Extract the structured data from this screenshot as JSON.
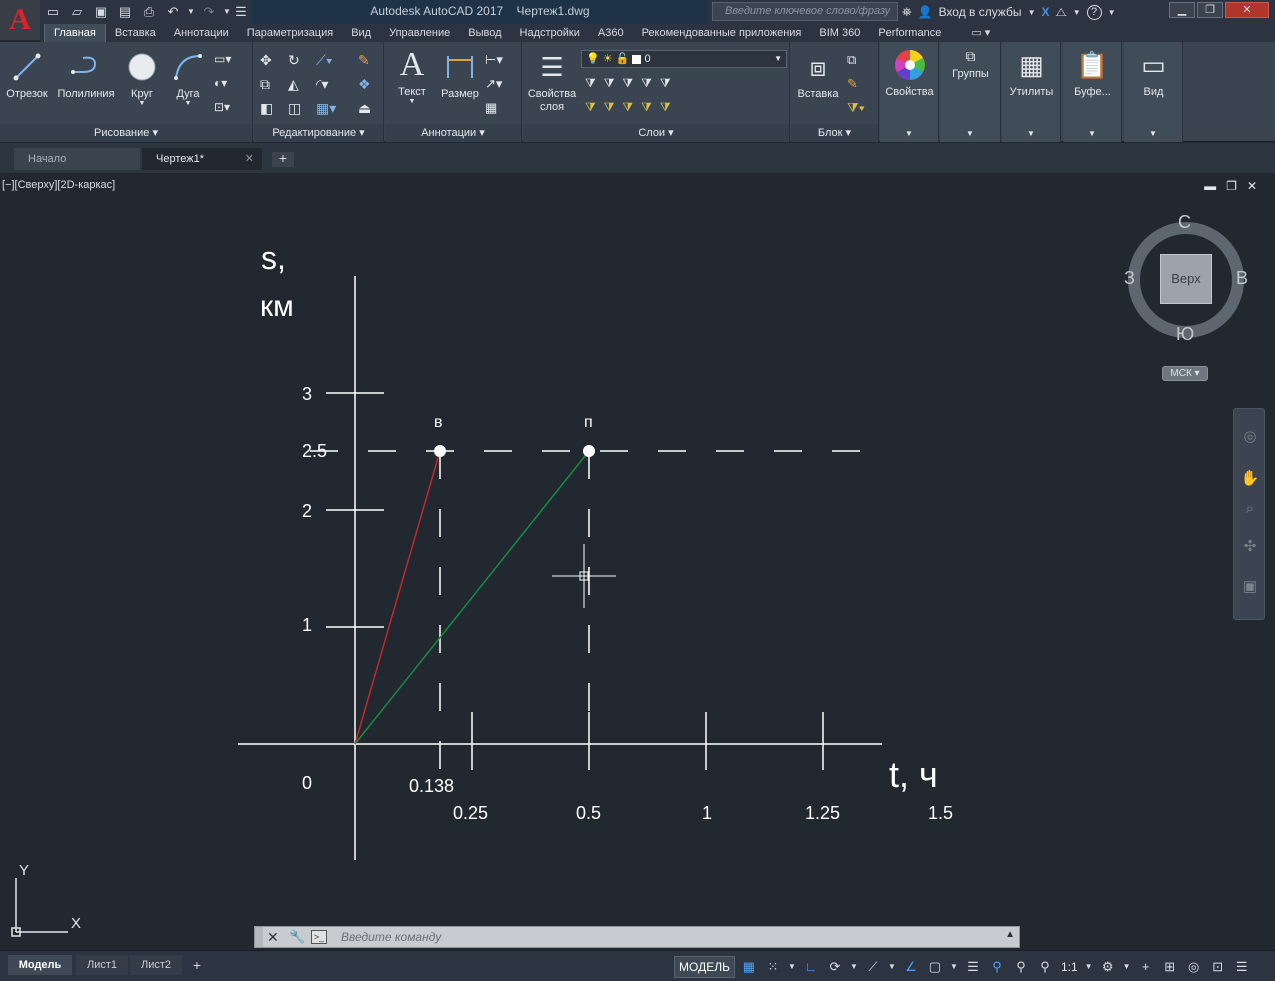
{
  "titlebar": {
    "app_title": "Autodesk AutoCAD 2017",
    "doc_name": "Чертеж1.dwg",
    "search_placeholder": "Введите ключевое слово/фразу",
    "sign_in": "Вход в службы",
    "help": "?"
  },
  "ribbon_tabs": [
    "Главная",
    "Вставка",
    "Аннотации",
    "Параметризация",
    "Вид",
    "Управление",
    "Вывод",
    "Надстройки",
    "A360",
    "Рекомендованные приложения",
    "BIM 360",
    "Performance"
  ],
  "ribbon": {
    "draw": {
      "footer": "Рисование",
      "line": "Отрезок",
      "polyline": "Полилиния",
      "circle": "Круг",
      "arc": "Дуга"
    },
    "modify": {
      "footer": "Редактирование"
    },
    "annotation": {
      "footer": "Аннотации",
      "text": "Текст",
      "dimension": "Размер"
    },
    "layers": {
      "footer": "Слои",
      "props_line1": "Свойства",
      "props_line2": "слоя",
      "current_layer": "0"
    },
    "block": {
      "footer": "Блок",
      "insert": "Вставка"
    },
    "properties": {
      "label": "Свойства"
    },
    "groups": {
      "label": "Группы"
    },
    "utilities": {
      "label": "Утилиты"
    },
    "clipboard": {
      "label": "Буфе..."
    },
    "view": {
      "label": "Вид"
    }
  },
  "doc_tabs": {
    "start": "Начало",
    "drawing": "Чертеж1*"
  },
  "viewport": {
    "label": "[−][Сверху][2D-каркас]"
  },
  "drawing": {
    "y_label_line1": "s,",
    "y_label_line2": "км",
    "x_label": "t, ч",
    "origin": "0",
    "y_ticks": [
      "3",
      "2.5",
      "2",
      "1"
    ],
    "x_ticks": [
      "0.138",
      "0.25",
      "0.5",
      "1",
      "1.25",
      "1.5"
    ],
    "point_v": "в",
    "point_p": "п",
    "colors": {
      "line_v": "#c0282e",
      "line_p": "#1a8a3e",
      "axes": "#ffffff"
    }
  },
  "viewcube": {
    "top": "Верх",
    "north": "С",
    "south": "Ю",
    "east": "В",
    "west": "З",
    "ucs_menu": "МСК"
  },
  "ucs": {
    "x": "X",
    "y": "Y"
  },
  "cmdline": {
    "placeholder": "Введите команду"
  },
  "layout_tabs": {
    "model": "Модель",
    "sheet1": "Лист1",
    "sheet2": "Лист2"
  },
  "status": {
    "model": "МОДЕЛЬ",
    "scale": "1:1"
  }
}
